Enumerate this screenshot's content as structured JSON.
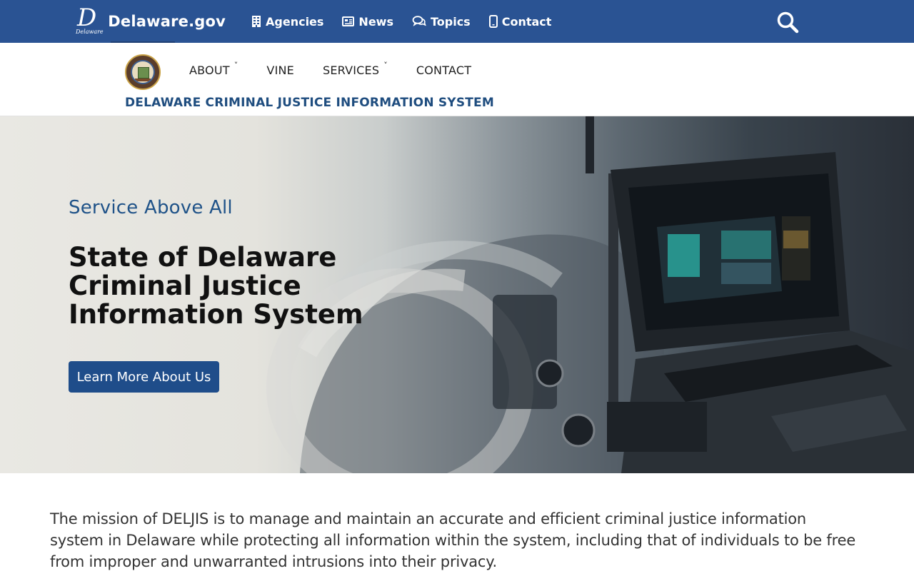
{
  "site": {
    "brand_mark": "D",
    "brand_mark_sub": "Delaware",
    "brand_name": "Delaware.gov"
  },
  "topnav": {
    "items": [
      {
        "label": "Agencies",
        "icon": "building-icon"
      },
      {
        "label": "News",
        "icon": "newspaper-icon"
      },
      {
        "label": "Topics",
        "icon": "chat-bubbles-icon"
      },
      {
        "label": "Contact",
        "icon": "mobile-phone-icon"
      }
    ],
    "search_icon": "search-icon"
  },
  "agency": {
    "seal_icon": "state-seal-icon",
    "nav": [
      {
        "label": "ABOUT",
        "has_dropdown": true
      },
      {
        "label": "VINE",
        "has_dropdown": false
      },
      {
        "label": "SERVICES",
        "has_dropdown": true
      },
      {
        "label": "CONTACT",
        "has_dropdown": false
      }
    ],
    "caret_glyph": "˅",
    "title": "DELAWARE CRIMINAL JUSTICE INFORMATION SYSTEM"
  },
  "hero": {
    "tagline": "Service Above All",
    "title": "State of Delaware Criminal Justice Information System",
    "button_label": "Learn More About Us"
  },
  "mission": {
    "text": "The mission of DELJIS is to manage and maintain an accurate and efficient criminal justice information system in Delaware while protecting all information within the system, including that of individuals to be free from improper and unwarranted intrusions into their privacy."
  },
  "colors": {
    "topbar": "#2a5393",
    "agency_title": "#1f4d7f",
    "tagline": "#1f5288",
    "button": "#1f4d8a"
  }
}
